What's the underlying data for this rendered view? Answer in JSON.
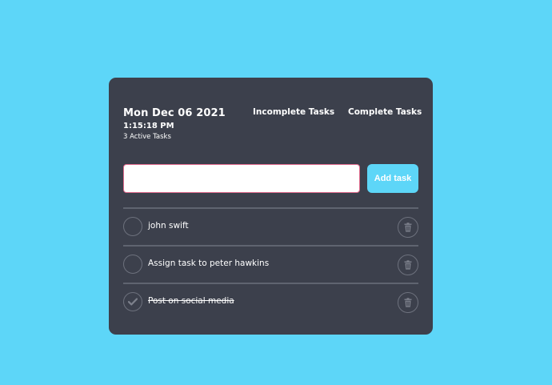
{
  "header": {
    "date": "Mon Dec 06 2021",
    "time": "1:15:18 PM",
    "active_tasks": "3 Active Tasks"
  },
  "filters": {
    "incomplete": "Incomplete Tasks",
    "complete": "Complete Tasks"
  },
  "add_form": {
    "input_value": "",
    "input_placeholder": "",
    "button_label": "Add task"
  },
  "tasks": [
    {
      "text": "john swift",
      "completed": false
    },
    {
      "text": "Assign task to peter hawkins",
      "completed": false
    },
    {
      "text": "Post on social media",
      "completed": true
    }
  ],
  "colors": {
    "background": "#5dd6f8",
    "card": "#3c404c",
    "accent": "#5dd6f8",
    "input_border": "#e06a8c",
    "divider": "#5f6470"
  },
  "icons": {
    "check": "check-icon",
    "delete": "trash-icon"
  }
}
